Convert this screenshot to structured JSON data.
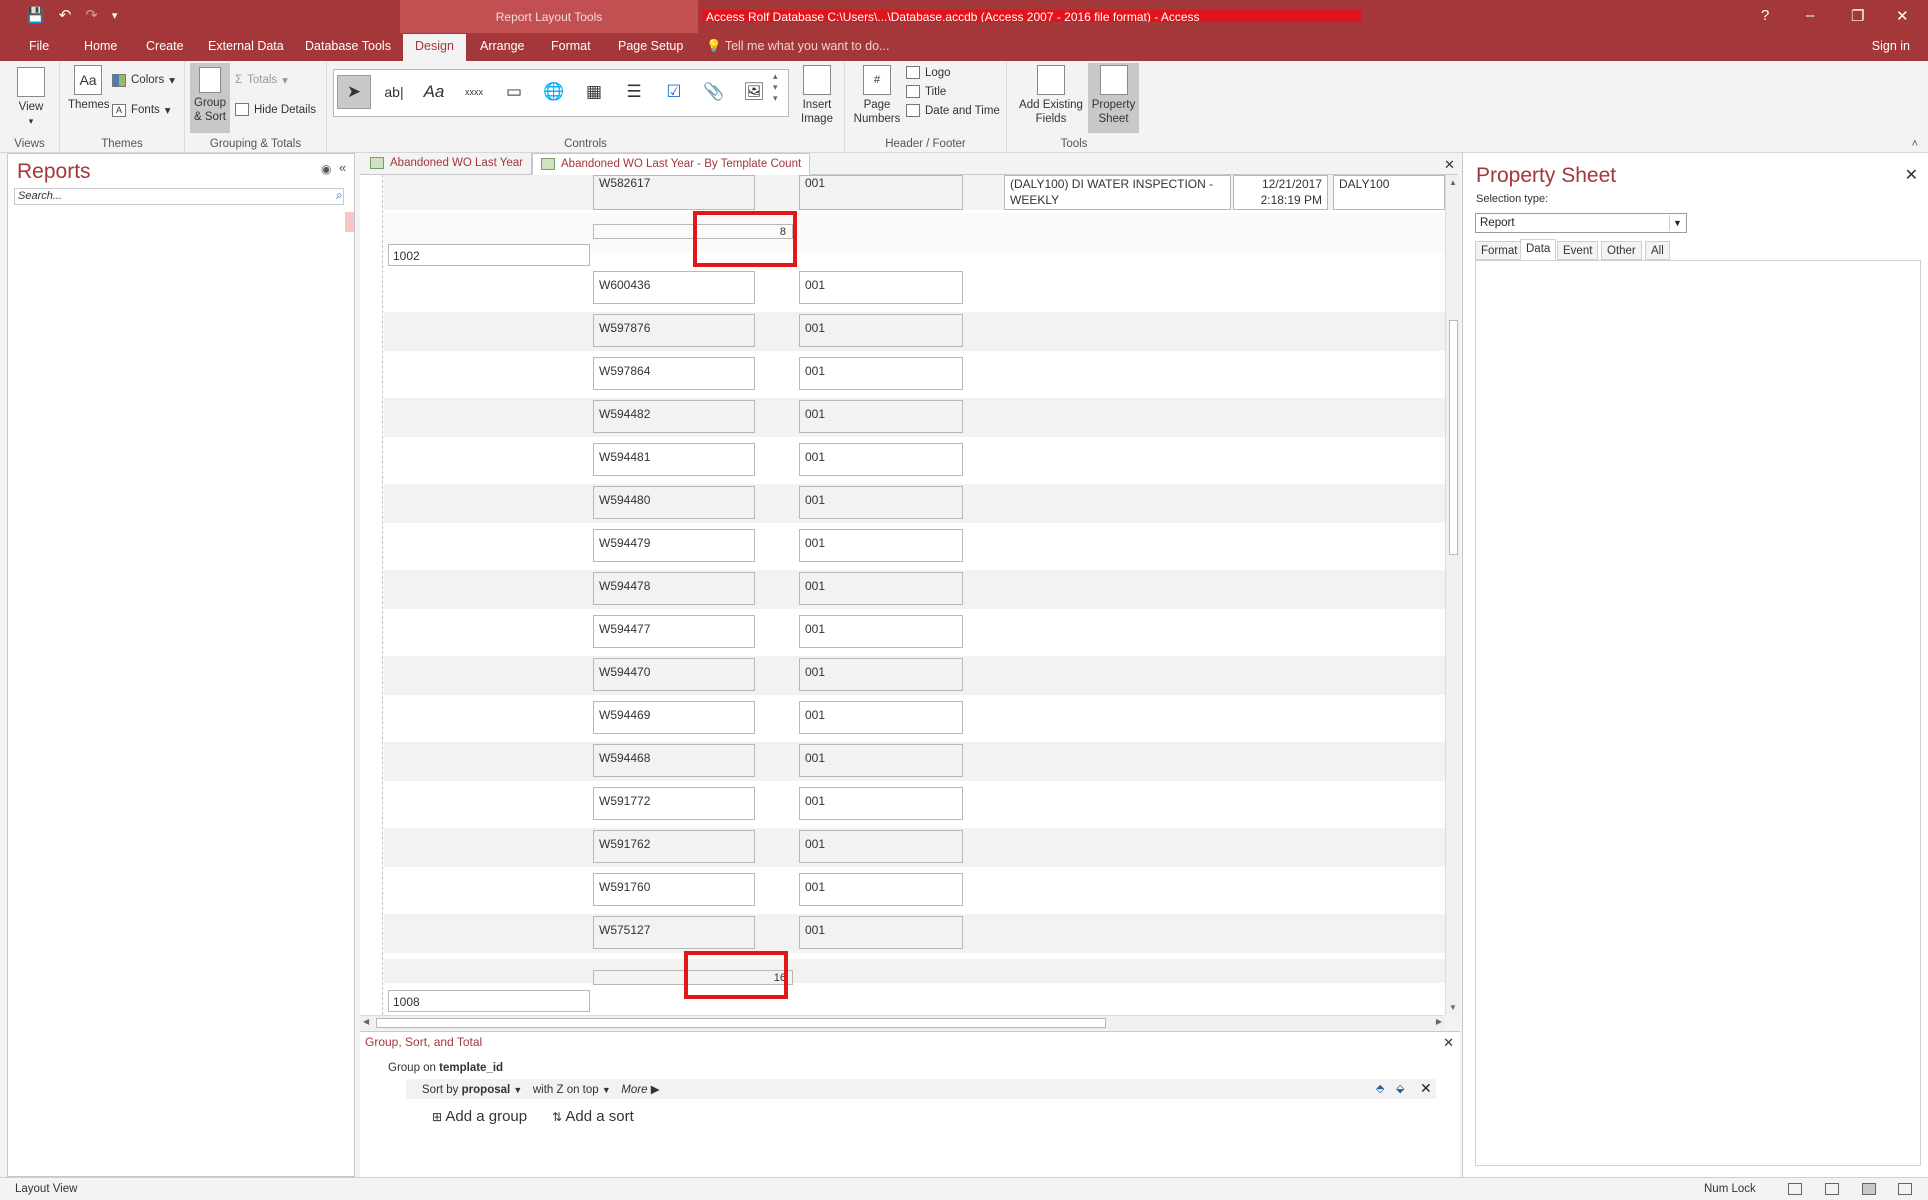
{
  "window": {
    "contextual_title": "Report Layout Tools",
    "title_redacted": "Access Rolf Database C:\\Users\\...\\Database.accdb (Access 2007 - 2016 file format) - Access",
    "help": "?",
    "minimize": "–",
    "restore": "❐",
    "close": "✕"
  },
  "quick_access": {
    "save": "💾",
    "undo": "↶",
    "redo": "↷",
    "customize": "▾"
  },
  "ribbon_tabs": [
    "File",
    "Home",
    "Create",
    "External Data",
    "Database Tools",
    "Design",
    "Arrange",
    "Format",
    "Page Setup"
  ],
  "active_tab": "Design",
  "tell_me": "Tell me what you want to do...",
  "sign_in": "Sign in",
  "ribbon": {
    "views": {
      "label": "Views",
      "view": "View"
    },
    "themes": {
      "label": "Themes",
      "themes": "Themes",
      "colors": "Colors",
      "fonts": "Fonts"
    },
    "grouping": {
      "label": "Grouping & Totals",
      "group_sort": "Group\n& Sort",
      "group_sort_1": "Group",
      "group_sort_2": "& Sort",
      "totals": "Totals",
      "hide_details": "Hide Details"
    },
    "controls": {
      "label": "Controls",
      "insert_image_1": "Insert",
      "insert_image_2": "Image"
    },
    "header_footer": {
      "label": "Header / Footer",
      "page_numbers_1": "Page",
      "page_numbers_2": "Numbers",
      "logo": "Logo",
      "title": "Title",
      "date_time": "Date and Time"
    },
    "tools": {
      "label": "Tools",
      "add_fields_1": "Add Existing",
      "add_fields_2": "Fields",
      "property_sheet_1": "Property",
      "property_sheet_2": "Sheet"
    }
  },
  "nav": {
    "title": "Reports",
    "search_placeholder": "Search..."
  },
  "doc_tabs": [
    "Abandoned WO Last Year",
    "Abandoned WO Last Year - By Template Count"
  ],
  "report": {
    "top_row": {
      "wo": "W582617",
      "code": "001",
      "desc": "(DALY100) DI WATER INSPECTION - WEEKLY",
      "date": "12/21/2017",
      "time": "2:18:19 PM",
      "template": "DALY100"
    },
    "count1": "8",
    "group1": "1002",
    "rows": [
      {
        "wo": "W600436",
        "code": "001"
      },
      {
        "wo": "W597876",
        "code": "001"
      },
      {
        "wo": "W597864",
        "code": "001"
      },
      {
        "wo": "W594482",
        "code": "001"
      },
      {
        "wo": "W594481",
        "code": "001"
      },
      {
        "wo": "W594480",
        "code": "001"
      },
      {
        "wo": "W594479",
        "code": "001"
      },
      {
        "wo": "W594478",
        "code": "001"
      },
      {
        "wo": "W594477",
        "code": "001"
      },
      {
        "wo": "W594470",
        "code": "001"
      },
      {
        "wo": "W594469",
        "code": "001"
      },
      {
        "wo": "W594468",
        "code": "001"
      },
      {
        "wo": "W591772",
        "code": "001"
      },
      {
        "wo": "W591762",
        "code": "001"
      },
      {
        "wo": "W591760",
        "code": "001"
      },
      {
        "wo": "W575127",
        "code": "001"
      }
    ],
    "count2": "16",
    "group2": "1008"
  },
  "group_sort_total": {
    "title": "Group, Sort, and Total",
    "group_on_label": "Group on",
    "group_on_field": "template_id",
    "sort_by_label": "Sort by",
    "sort_by_field": "proposal",
    "order": "with Z on top",
    "more": "More ▶",
    "add_group": "Add a group",
    "add_sort": "Add a sort"
  },
  "property_sheet": {
    "title": "Property Sheet",
    "selection_type_label": "Selection type:",
    "selection": "Report",
    "tabs": [
      "Format",
      "Data",
      "Event",
      "Other",
      "All"
    ],
    "active_tab": "Data"
  },
  "status": {
    "left": "Layout View",
    "numlock": "Num Lock"
  },
  "colors": {
    "accent": "#a4373a",
    "highlight": "#e01818"
  }
}
